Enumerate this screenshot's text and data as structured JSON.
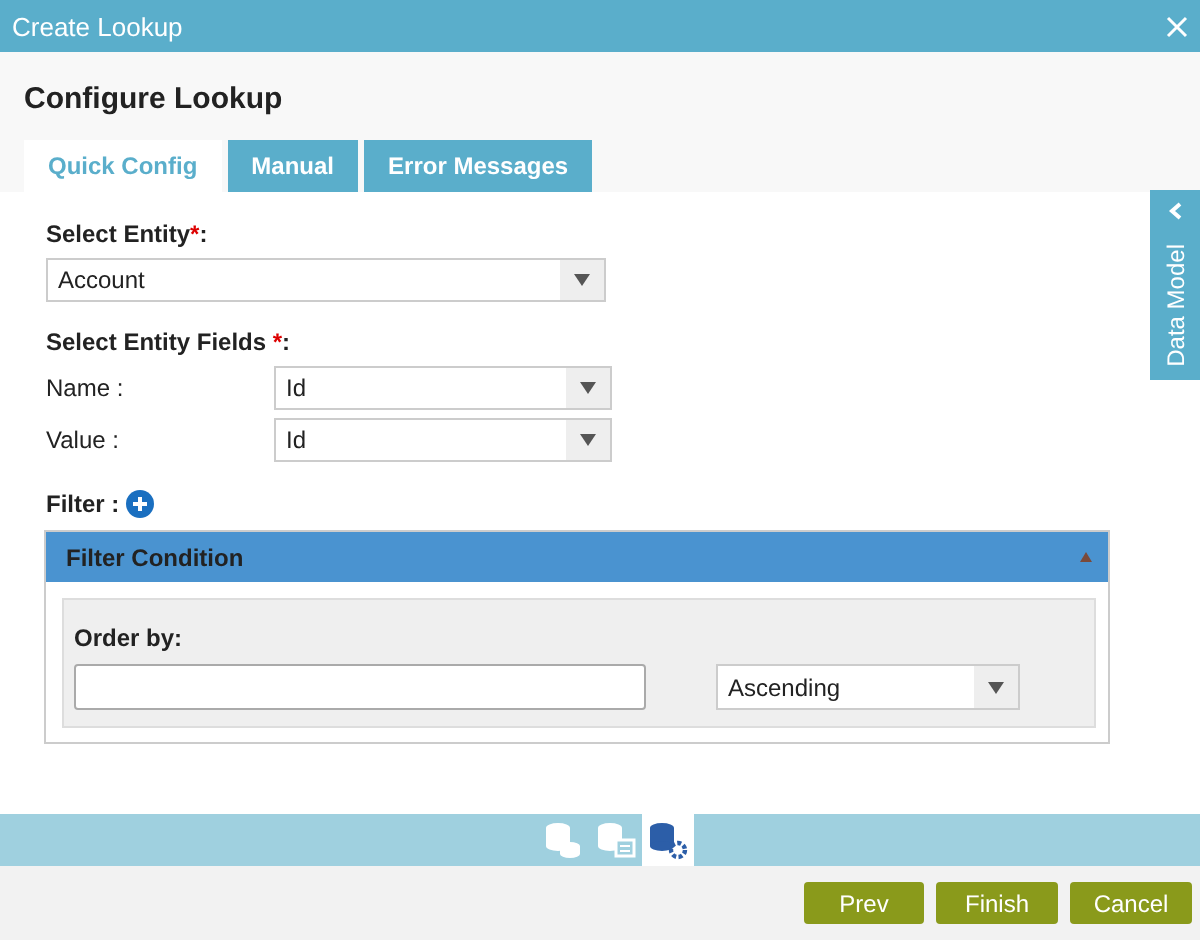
{
  "window": {
    "title": "Create Lookup"
  },
  "heading": "Configure Lookup",
  "tabs": [
    {
      "label": "Quick Config",
      "selected": true
    },
    {
      "label": "Manual",
      "selected": false
    },
    {
      "label": "Error Messages",
      "selected": false
    }
  ],
  "entity": {
    "label": "Select Entity",
    "required_mark": "*",
    "suffix": ":",
    "value": "Account"
  },
  "fields": {
    "label": "Select Entity Fields ",
    "required_mark": "*",
    "suffix": ":",
    "rows": [
      {
        "label": "Name :",
        "value": "Id"
      },
      {
        "label": "Value :",
        "value": "Id"
      }
    ]
  },
  "filter": {
    "label": "Filter :"
  },
  "filter_condition": {
    "title": "Filter Condition",
    "expanded": true,
    "order_label": "Order by:",
    "order_value": "Ascending"
  },
  "side_panel": {
    "label": "Data Model"
  },
  "toolbar_tabs": [
    {
      "selected": false
    },
    {
      "selected": false
    },
    {
      "selected": true
    }
  ],
  "buttons": [
    "Prev",
    "Finish",
    "Cancel"
  ]
}
